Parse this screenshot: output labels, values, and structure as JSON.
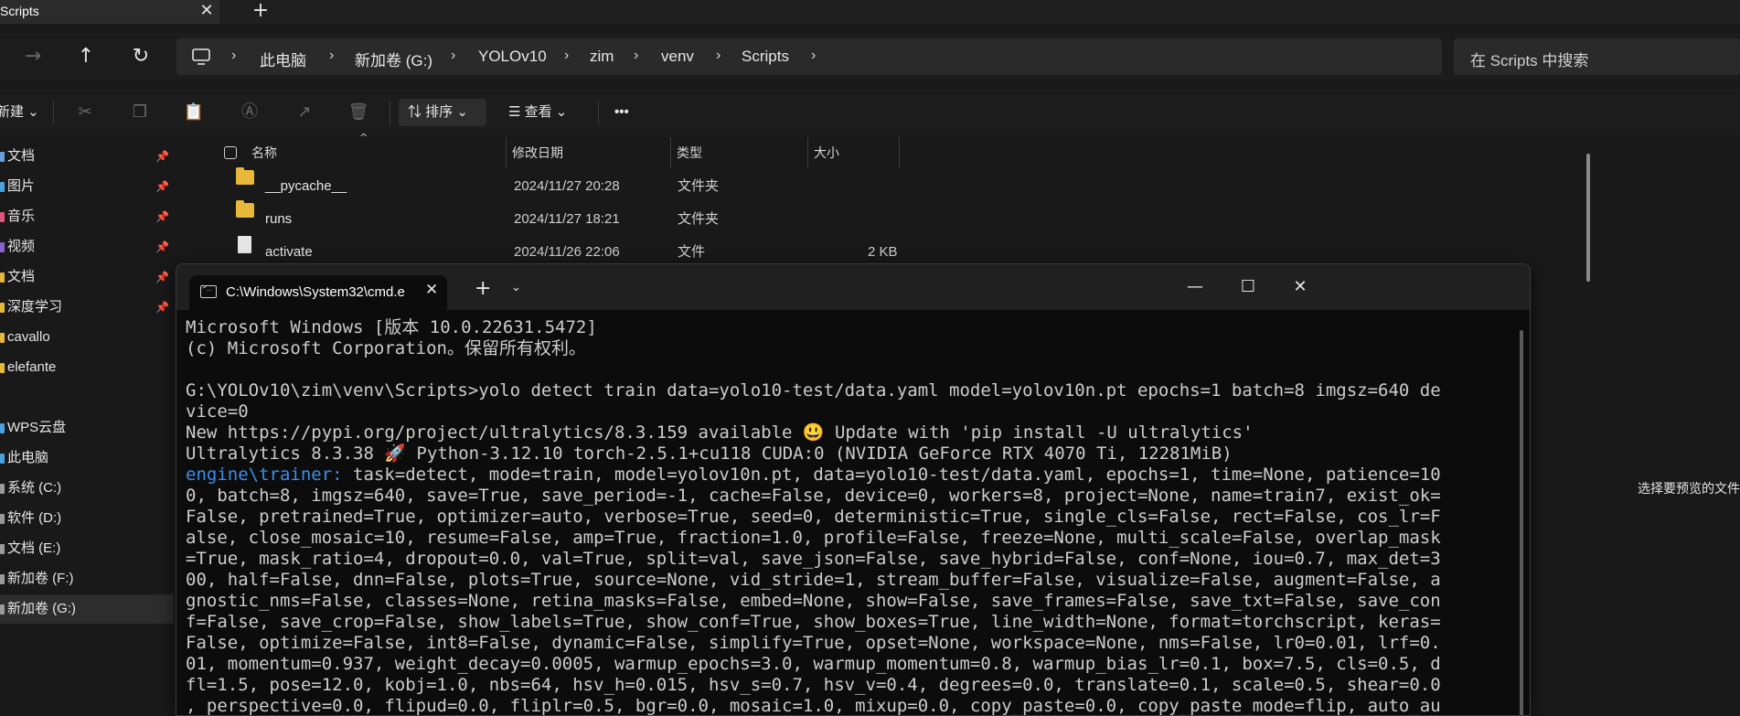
{
  "explorer": {
    "tab_title": "Scripts",
    "tab_close": "✕",
    "new_tab": "+",
    "breadcrumb": [
      "此电脑",
      "新加卷 (G:)",
      "YOLOv10",
      "zim",
      "venv",
      "Scripts"
    ],
    "search_placeholder": "在 Scripts 中搜索",
    "toolbar": {
      "new_label": "新建",
      "sort_label": "排序",
      "view_label": "查看",
      "more_label": "•••"
    },
    "sidebar": [
      {
        "label": "文档",
        "pinned": true,
        "color": "#6ca0dc"
      },
      {
        "label": "图片",
        "pinned": true,
        "color": "#4aa3df"
      },
      {
        "label": "音乐",
        "pinned": true,
        "color": "#e0567a"
      },
      {
        "label": "视频",
        "pinned": true,
        "color": "#8a63d2"
      },
      {
        "label": "文档",
        "pinned": true,
        "color": "#e8b83a"
      },
      {
        "label": "深度学习",
        "pinned": true,
        "color": "#e8b83a"
      },
      {
        "label": "cavallo",
        "pinned": false,
        "color": "#e8b83a"
      },
      {
        "label": "elefante",
        "pinned": false,
        "color": "#e8b83a"
      },
      {
        "label": "WPS云盘",
        "pinned": false,
        "color": "#4aa3df"
      },
      {
        "label": "此电脑",
        "pinned": false,
        "color": "#4aa3df"
      },
      {
        "label": "系统 (C:)",
        "pinned": false,
        "color": "#9a9a9a"
      },
      {
        "label": "软件 (D:)",
        "pinned": false,
        "color": "#9a9a9a"
      },
      {
        "label": "文档 (E:)",
        "pinned": false,
        "color": "#9a9a9a"
      },
      {
        "label": "新加卷 (F:)",
        "pinned": false,
        "color": "#9a9a9a"
      },
      {
        "label": "新加卷 (G:)",
        "pinned": false,
        "color": "#9a9a9a"
      }
    ],
    "columns": {
      "name": "名称",
      "modified": "修改日期",
      "type": "类型",
      "size": "大小"
    },
    "files": [
      {
        "name": "__pycache__",
        "modified": "2024/11/27 20:28",
        "type": "文件夹",
        "size": "",
        "kind": "folder"
      },
      {
        "name": "runs",
        "modified": "2024/11/27 18:21",
        "type": "文件夹",
        "size": "",
        "kind": "folder"
      },
      {
        "name": "activate",
        "modified": "2024/11/26 22:06",
        "type": "文件",
        "size": "2 KB",
        "kind": "file"
      }
    ],
    "preview_text": "选择要预览的文件"
  },
  "terminal": {
    "tab_title": "C:\\Windows\\System32\\cmd.e",
    "lines": [
      {
        "text": "Microsoft Windows [版本 10.0.22631.5472]"
      },
      {
        "text": "(c) Microsoft Corporation。保留所有权利。"
      },
      {
        "text": ""
      },
      {
        "text": "G:\\YOLOv10\\zim\\venv\\Scripts>yolo detect train data=yolo10-test/data.yaml model=yolov10n.pt epochs=1 batch=8 imgsz=640 de"
      },
      {
        "text": "vice=0"
      },
      {
        "text": "New https://pypi.org/project/ultralytics/8.3.159 available 😃 Update with 'pip install -U ultralytics'"
      },
      {
        "text": "Ultralytics 8.3.38 🚀 Python-3.12.10 torch-2.5.1+cu118 CUDA:0 (NVIDIA GeForce RTX 4070 Ti, 12281MiB)"
      },
      {
        "prefix": "engine\\trainer:",
        "text": " task=detect, mode=train, model=yolov10n.pt, data=yolo10-test/data.yaml, epochs=1, time=None, patience=10"
      },
      {
        "text": "0, batch=8, imgsz=640, save=True, save_period=-1, cache=False, device=0, workers=8, project=None, name=train7, exist_ok="
      },
      {
        "text": "False, pretrained=True, optimizer=auto, verbose=True, seed=0, deterministic=True, single_cls=False, rect=False, cos_lr=F"
      },
      {
        "text": "alse, close_mosaic=10, resume=False, amp=True, fraction=1.0, profile=False, freeze=None, multi_scale=False, overlap_mask"
      },
      {
        "text": "=True, mask_ratio=4, dropout=0.0, val=True, split=val, save_json=False, save_hybrid=False, conf=None, iou=0.7, max_det=3"
      },
      {
        "text": "00, half=False, dnn=False, plots=True, source=None, vid_stride=1, stream_buffer=False, visualize=False, augment=False, a"
      },
      {
        "text": "gnostic_nms=False, classes=None, retina_masks=False, embed=None, show=False, save_frames=False, save_txt=False, save_con"
      },
      {
        "text": "f=False, save_crop=False, show_labels=True, show_conf=True, show_boxes=True, line_width=None, format=torchscript, keras="
      },
      {
        "text": "False, optimize=False, int8=False, dynamic=False, simplify=True, opset=None, workspace=None, nms=False, lr0=0.01, lrf=0."
      },
      {
        "text": "01, momentum=0.937, weight_decay=0.0005, warmup_epochs=3.0, warmup_momentum=0.8, warmup_bias_lr=0.1, box=7.5, cls=0.5, d"
      },
      {
        "text": "fl=1.5, pose=12.0, kobj=1.0, nbs=64, hsv_h=0.015, hsv_s=0.7, hsv_v=0.4, degrees=0.0, translate=0.1, scale=0.5, shear=0.0"
      },
      {
        "text": ", perspective=0.0, flipud=0.0, fliplr=0.5, bgr=0.0, mosaic=1.0, mixup=0.0, copy_paste=0.0, copy_paste_mode=flip, auto_au"
      }
    ]
  }
}
